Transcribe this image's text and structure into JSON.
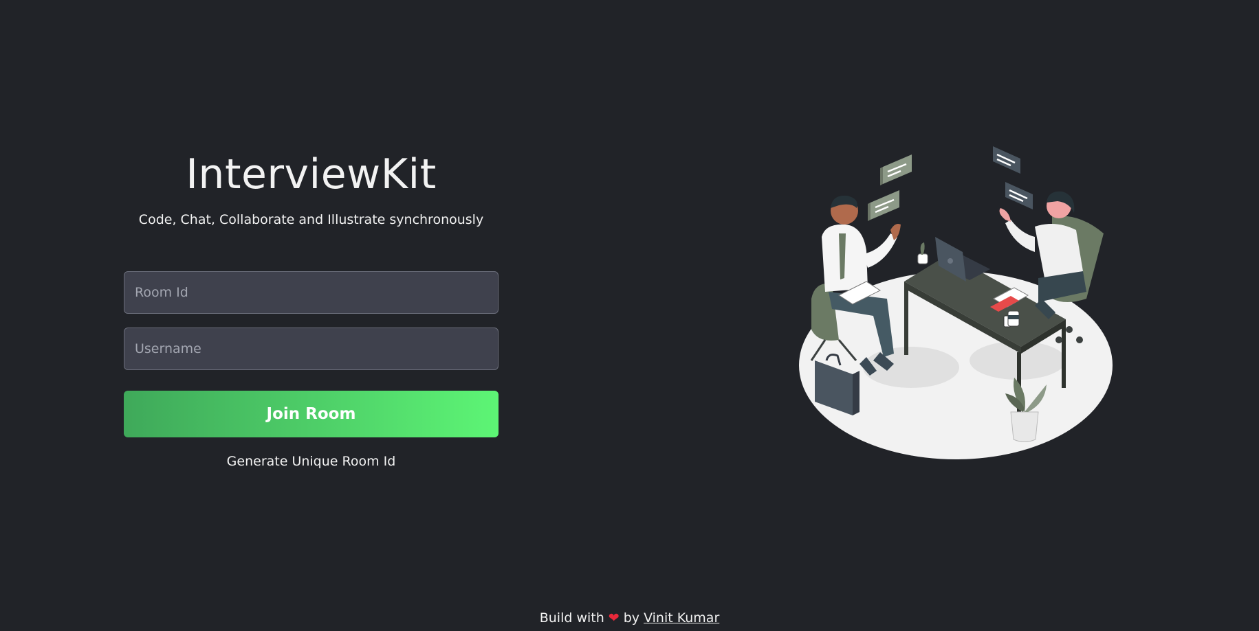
{
  "app": {
    "title": "InterviewKit",
    "subtitle": "Code, Chat, Collaborate and Illustrate synchronously"
  },
  "form": {
    "room_placeholder": "Room Id",
    "username_placeholder": "Username",
    "join_label": "Join Room",
    "generate_label": "Generate Unique Room Id"
  },
  "footer": {
    "prefix": "Build with",
    "heart": "❤",
    "by": "by",
    "author": "Vinit Kumar"
  },
  "colors": {
    "background": "#212328",
    "input_bg": "#3f414d",
    "accent_start": "#3fa95a",
    "accent_end": "#5df575",
    "heart": "#e8283a"
  },
  "icons": {
    "illustration": "interview-illustration",
    "heart": "heart-icon"
  }
}
